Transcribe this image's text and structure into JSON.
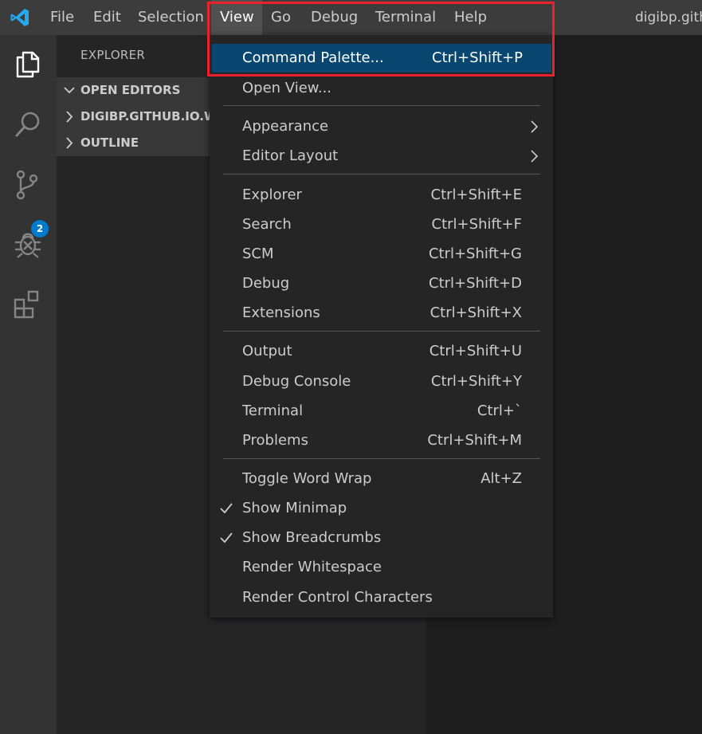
{
  "titlebar": {
    "menus": [
      "File",
      "Edit",
      "Selection",
      "View",
      "Go",
      "Debug",
      "Terminal",
      "Help"
    ],
    "active_menu": "View",
    "window_title": "digibp.githu"
  },
  "activitybar": {
    "icons": [
      "explorer-icon",
      "search-icon",
      "source-control-icon",
      "debug-icon",
      "extensions-icon"
    ],
    "scm_badge": "2"
  },
  "sidebar": {
    "title": "EXPLORER",
    "sections": [
      {
        "label": "OPEN EDITORS",
        "expanded": true
      },
      {
        "label": "DIGIBP.GITHUB.IO.W",
        "expanded": false
      },
      {
        "label": "OUTLINE",
        "expanded": false
      }
    ]
  },
  "view_menu": {
    "items": [
      {
        "label": "Command Palette...",
        "shortcut": "Ctrl+Shift+P",
        "selected": true
      },
      {
        "label": "Open View...",
        "shortcut": ""
      },
      {
        "label": "Appearance",
        "submenu": true
      },
      {
        "label": "Editor Layout",
        "submenu": true
      },
      {
        "label": "Explorer",
        "shortcut": "Ctrl+Shift+E"
      },
      {
        "label": "Search",
        "shortcut": "Ctrl+Shift+F"
      },
      {
        "label": "SCM",
        "shortcut": "Ctrl+Shift+G"
      },
      {
        "label": "Debug",
        "shortcut": "Ctrl+Shift+D"
      },
      {
        "label": "Extensions",
        "shortcut": "Ctrl+Shift+X"
      },
      {
        "label": "Output",
        "shortcut": "Ctrl+Shift+U"
      },
      {
        "label": "Debug Console",
        "shortcut": "Ctrl+Shift+Y"
      },
      {
        "label": "Terminal",
        "shortcut": "Ctrl+`"
      },
      {
        "label": "Problems",
        "shortcut": "Ctrl+Shift+M"
      },
      {
        "label": "Toggle Word Wrap",
        "shortcut": "Alt+Z"
      },
      {
        "label": "Show Minimap",
        "checked": true
      },
      {
        "label": "Show Breadcrumbs",
        "checked": true
      },
      {
        "label": "Render Whitespace"
      },
      {
        "label": "Render Control Characters"
      }
    ]
  },
  "colors": {
    "accent": "#007acc",
    "menu_selection": "#094771",
    "highlight_box": "#e8232f"
  }
}
